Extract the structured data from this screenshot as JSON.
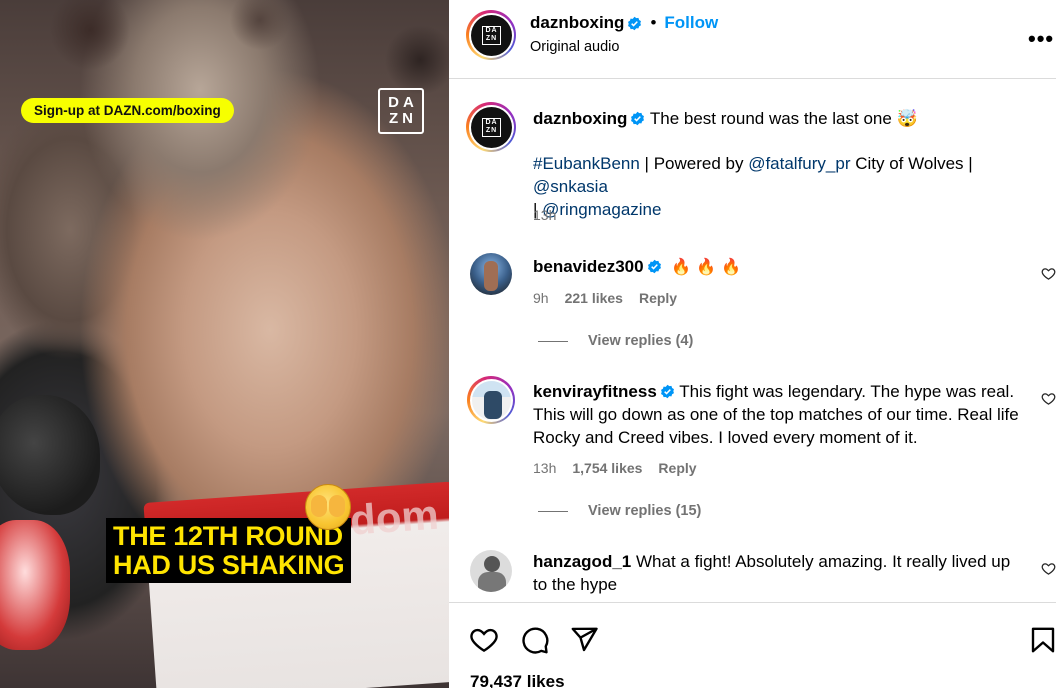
{
  "video": {
    "signup_text": "Sign-up at DAZN.com/boxing",
    "logo_line1": "DA",
    "logo_line2": "ZN",
    "trunks_text": "dom",
    "caption_line1": "THE 12TH ROUND",
    "caption_line2": "HAD US SHAKING"
  },
  "header": {
    "username": "daznboxing",
    "follow_label": "Follow",
    "separator": "•",
    "audio": "Original audio",
    "avatar_line1": "DA",
    "avatar_line2": "ZN"
  },
  "post_caption": {
    "username": "daznboxing",
    "text": "The best round was the last one",
    "emoji": "🤯",
    "hashtag": "#EubankBenn",
    "powered": " | Powered by ",
    "mention1": "@fatalfury_pr",
    "middle": " City of Wolves | ",
    "mention2": "@snkasia",
    "pipe": "| ",
    "mention3": "@ringmagazine",
    "time": "13h"
  },
  "comments": [
    {
      "username": "benavidez300",
      "verified": true,
      "text": "",
      "emojis": [
        "🔥",
        "🔥",
        "🔥"
      ],
      "time": "9h",
      "likes": "221 likes",
      "reply_label": "Reply",
      "view_replies": "View replies (4)"
    },
    {
      "username": "kenvirayfitness",
      "verified": true,
      "text": "This fight was legendary. The hype was real. This will go down as one of the top matches of our time. Real life Rocky and Creed vibes. I loved every moment of it.",
      "time": "13h",
      "likes": "1,754 likes",
      "reply_label": "Reply",
      "view_replies": "View replies (15)"
    },
    {
      "username": "hanzagod_1",
      "verified": false,
      "text": "What a fight! Absolutely amazing. It really lived up to the hype"
    }
  ],
  "footer": {
    "likes": "79,437 likes"
  },
  "colors": {
    "accent_blue": "#0095f6",
    "link_blue": "#00376b",
    "muted": "#737373",
    "caption_yellow": "#ffe400",
    "signup_yellow": "#f7ff00"
  },
  "icons": [
    "verified-badge-icon",
    "more-options-icon",
    "heart-icon",
    "comment-icon",
    "share-icon",
    "bookmark-icon",
    "fire-emoji-icon"
  ]
}
